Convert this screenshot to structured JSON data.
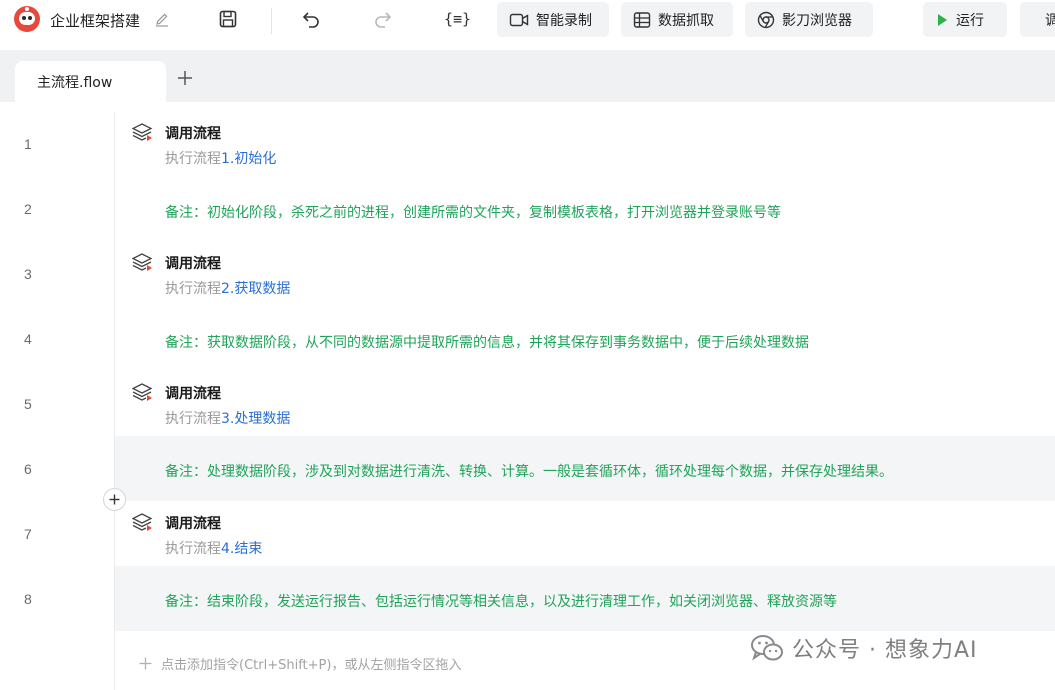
{
  "toolbar": {
    "app_title": "企业框架搭建",
    "var_label": "{≡}",
    "buttons": {
      "record": "智能录制",
      "scrape": "数据抓取",
      "browser": "影刀浏览器",
      "run": "运行",
      "next_partial": "调"
    }
  },
  "tabs": [
    {
      "label": "主流程.flow"
    }
  ],
  "lines": [
    {
      "no": "1",
      "kind": "command",
      "title": "调用流程",
      "prefix": "执行流程",
      "target": "1.初始化"
    },
    {
      "no": "2",
      "kind": "comment",
      "text": "备注：初始化阶段，杀死之前的进程，创建所需的文件夹，复制模板表格，打开浏览器并登录账号等"
    },
    {
      "no": "3",
      "kind": "command",
      "title": "调用流程",
      "prefix": "执行流程",
      "target": "2.获取数据"
    },
    {
      "no": "4",
      "kind": "comment",
      "text": "备注：获取数据阶段，从不同的数据源中提取所需的信息，并将其保存到事务数据中，便于后续处理数据"
    },
    {
      "no": "5",
      "kind": "command",
      "title": "调用流程",
      "prefix": "执行流程",
      "target": "3.处理数据"
    },
    {
      "no": "6",
      "kind": "comment",
      "text": "备注：处理数据阶段，涉及到对数据进行清洗、转换、计算。一般是套循环体，循环处理每个数据，并保存处理结果。"
    },
    {
      "no": "7",
      "kind": "command",
      "title": "调用流程",
      "prefix": "执行流程",
      "target": "4.结束"
    },
    {
      "no": "8",
      "kind": "comment",
      "text": "备注：结束阶段，发送运行报告、包括运行情况等相关信息，以及进行清理工作，如关闭浏览器、释放资源等"
    }
  ],
  "add_hint": "点击添加指令(Ctrl+Shift+P)，或从左侧指令区拖入",
  "watermark": "公众号 · 想象力AI",
  "colors": {
    "comment": "#20a35a",
    "link": "#2a6fd6",
    "muted": "#9a9a9a",
    "run_icon": "#2bb24c",
    "logo": "#e8473b"
  },
  "icons": {
    "edit": "pencil-icon",
    "save": "save-icon",
    "undo": "undo-icon",
    "redo": "redo-icon",
    "variables": "variables-icon",
    "record": "video-camera-icon",
    "scrape": "table-grid-icon",
    "browser": "chrome-browser-icon",
    "run": "play-icon",
    "command": "layers-stack-icon",
    "add": "plus-icon"
  }
}
